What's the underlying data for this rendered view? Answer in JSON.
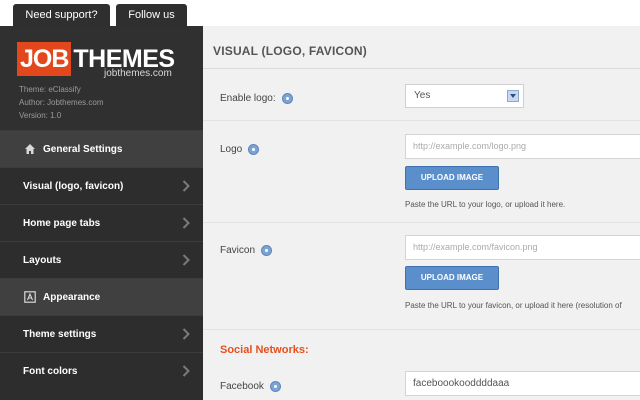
{
  "top_tabs": {
    "support": "Need support?",
    "follow": "Follow us"
  },
  "brand": {
    "logo_job": "JOB",
    "logo_themes": "THEMES",
    "site": "jobthemes.com",
    "theme": "Theme: eClassify",
    "author": "Author: Jobthemes.com",
    "version": "Version: 1.0"
  },
  "sidebar": {
    "general_settings": "General Settings",
    "visual": "Visual (logo, favicon)",
    "home_tabs": "Home page tabs",
    "layouts": "Layouts",
    "appearance": "Appearance",
    "theme_settings": "Theme settings",
    "font_colors": "Font colors"
  },
  "main": {
    "title": "VISUAL (LOGO, FAVICON)",
    "enable_logo": {
      "label": "Enable logo:",
      "value": "Yes"
    },
    "logo": {
      "label": "Logo",
      "placeholder": "http://example.com/logo.png",
      "button": "UPLOAD IMAGE",
      "hint": "Paste the URL to your logo, or upload it here."
    },
    "favicon": {
      "label": "Favicon",
      "placeholder": "http://example.com/favicon.png",
      "button": "UPLOAD IMAGE",
      "hint": "Paste the URL to your favicon, or upload it here (resolution of"
    },
    "social_heading": "Social Networks:",
    "facebook": {
      "label": "Facebook",
      "value": "faceboookooddddaaa"
    }
  },
  "colors": {
    "accent": "#e3471c",
    "button": "#5a8fcb",
    "sidebar": "#2d2d2d"
  }
}
